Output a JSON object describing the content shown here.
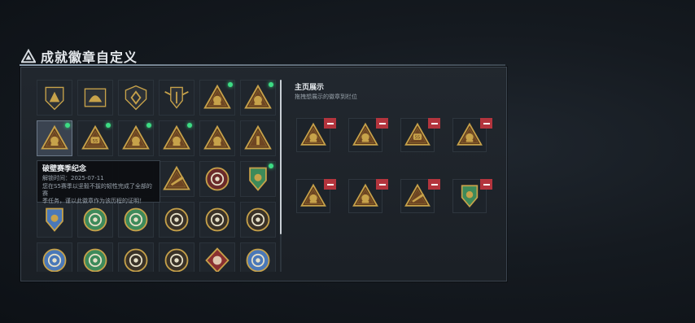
{
  "header": {
    "title": "成就徽章自定义"
  },
  "grid": {
    "rows": [
      [
        {
          "icon": "pyramid-badge-icon",
          "dot": false
        },
        {
          "icon": "helmet-badge-icon",
          "dot": false
        },
        {
          "icon": "shield-badge-icon",
          "dot": false
        },
        {
          "icon": "wings-shield-badge-icon",
          "dot": false
        },
        {
          "icon": "triangle-fist-badge-icon",
          "dot": true
        },
        {
          "icon": "triangle-star-badge-icon",
          "dot": true
        }
      ],
      [
        {
          "icon": "triangle-archive-badge-icon",
          "dot": true,
          "selected": true
        },
        {
          "icon": "triangle-s5-badge-icon",
          "dot": true
        },
        {
          "icon": "triangle-crate-badge-icon",
          "dot": true
        },
        {
          "icon": "triangle-medal-badge-icon",
          "dot": true
        },
        {
          "icon": "triangle-vehicle-badge-icon",
          "dot": false
        },
        {
          "icon": "triangle-number-badge-icon",
          "dot": false
        }
      ],
      [
        {
          "icon": "hidden",
          "dot": false
        },
        {
          "icon": "hidden",
          "dot": false
        },
        {
          "icon": "hidden",
          "dot": false
        },
        {
          "icon": "triangle-gun-badge-icon",
          "dot": false
        },
        {
          "icon": "star-medal-badge-icon",
          "dot": false
        },
        {
          "icon": "green-shield-badge-icon",
          "dot": true
        }
      ],
      [
        {
          "icon": "blue-shield-star-badge-icon",
          "dot": false
        },
        {
          "icon": "green-lion-badge-icon",
          "dot": false
        },
        {
          "icon": "green-emblem-badge-icon",
          "dot": false
        },
        {
          "icon": "skull-badge-icon",
          "dot": false
        },
        {
          "icon": "laurel-badge-icon",
          "dot": false
        },
        {
          "icon": "sunburst-badge-icon",
          "dot": false
        }
      ],
      [
        {
          "icon": "blue-eagle-badge-icon",
          "dot": false
        },
        {
          "icon": "green-rifles-badge-icon",
          "dot": false
        },
        {
          "icon": "no-entry-badge-icon",
          "dot": false
        },
        {
          "icon": "crossed-swords-badge-icon",
          "dot": false
        },
        {
          "icon": "red-diamond-badge-icon",
          "dot": false
        },
        {
          "icon": "blue-wolf-badge-icon",
          "dot": false
        }
      ]
    ]
  },
  "tooltip": {
    "name": "破壁赛季纪念",
    "time": "解锁时间：2025-07-11",
    "desc1": "您在S5赛季以坚毅不拔的韧性完成了全部的赛",
    "desc2": "季任务，谨以此徽章作为该历程的证明！"
  },
  "display": {
    "title": "主页展示",
    "subtitle": "拖拽想展示的徽章到栏位",
    "slots": [
      {
        "icon": "triangle-medal-badge-icon"
      },
      {
        "icon": "triangle-crate-badge-icon"
      },
      {
        "icon": "triangle-s5-badge-icon"
      },
      {
        "icon": "triangle-archive-badge-icon"
      },
      {
        "icon": "triangle-star-badge-icon"
      },
      {
        "icon": "triangle-fist-badge-icon"
      },
      {
        "icon": "triangle-gun-badge-icon"
      },
      {
        "icon": "green-shield-badge-icon"
      }
    ]
  },
  "colors": {
    "gold": "#c7a24a",
    "brown": "#5e3a1c",
    "red": "#b3343d",
    "green_dot": "#3ddc84",
    "accent_blue": "#4a78b8",
    "accent_green": "#3d8a5a"
  }
}
